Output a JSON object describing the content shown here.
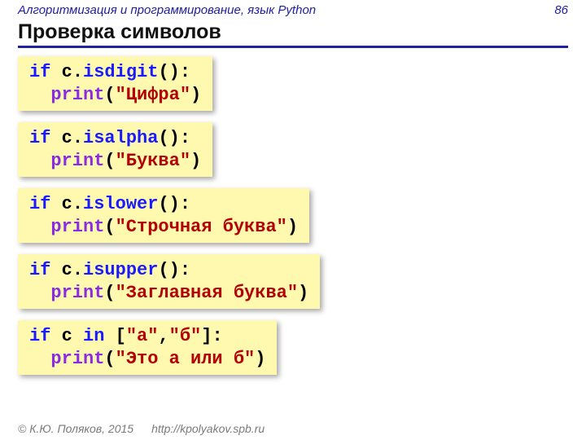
{
  "header": {
    "course": "Алгоритмизация и программирование, язык Python",
    "page": "86"
  },
  "title": "Проверка символов",
  "kw_if": "if",
  "kw_in": "in",
  "var_c": "c",
  "fn_print": "print",
  "dot": ".",
  "open_call": "():",
  "open_p": "(",
  "close_p": ")",
  "blocks": [
    {
      "method": "isdigit",
      "literal": "\"Цифра\""
    },
    {
      "method": "isalpha",
      "literal": "\"Буква\""
    },
    {
      "method": "islower",
      "literal": "\"Строчная буква\""
    },
    {
      "method": "isupper",
      "literal": "\"Заглавная буква\""
    }
  ],
  "block5": {
    "list_open": "[",
    "str_a": "\"а\"",
    "comma": ",",
    "str_b": "\"б\"",
    "list_close": "]:",
    "literal": "\"Это а или б\""
  },
  "footer": {
    "copyright": "© К.Ю. Поляков, 2015",
    "url": "http://kpolyakov.spb.ru"
  }
}
